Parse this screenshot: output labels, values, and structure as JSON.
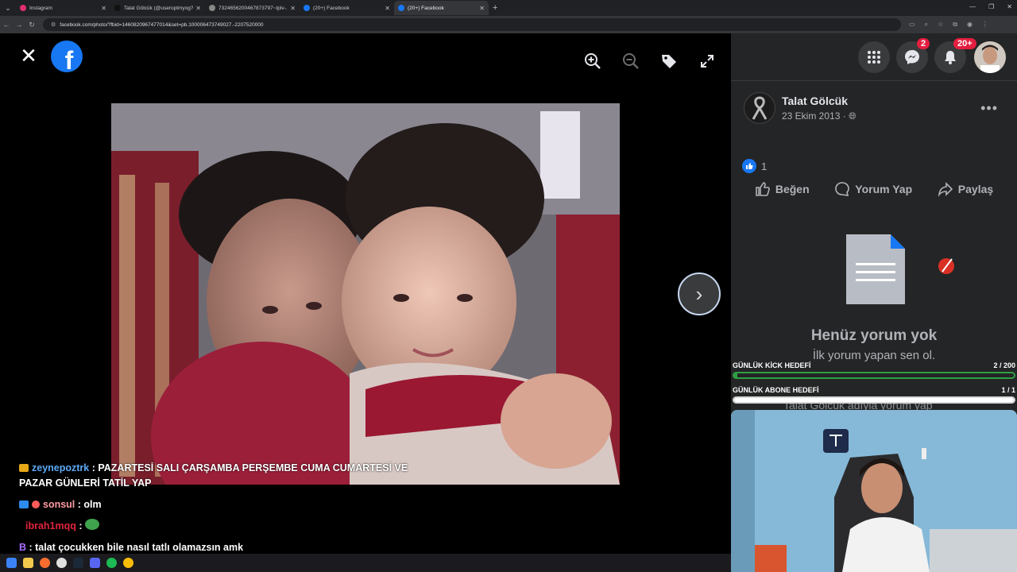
{
  "browser": {
    "tabs": [
      {
        "title": "Instagram",
        "color": "#e1306c",
        "active": false
      },
      {
        "title": "Talat Gölcük (@useroptmyog?...",
        "color": "#111111",
        "active": false
      },
      {
        "title": "7324656200467873797~tplv-...",
        "color": "#888888",
        "active": false
      },
      {
        "title": "(20+) Facebook",
        "color": "#1877f2",
        "active": false
      },
      {
        "title": "(20+) Facebook",
        "color": "#1877f2",
        "active": true
      }
    ],
    "url": "facebook.com/photo/?fbid=1460820967477014&set=pb.100006473749027.-2207520000"
  },
  "viewer": {
    "close_icon": "close-icon",
    "tools": [
      "zoom-in-icon",
      "zoom-out-icon",
      "tag-icon",
      "fullscreen-icon"
    ]
  },
  "chat": [
    {
      "user": "zeynepoztrk",
      "user_color": "#5aa9f5",
      "text": "PAZARTESİ SALI ÇARŞAMBA PERŞEMBE CUMA CUMARTESİ VE PAZAR GÜNLERİ TATİL YAP",
      "badge_color": "#e6a817"
    },
    {
      "user": "sonsul",
      "user_color": "#ff9aa2",
      "text": "olm",
      "badge_color": "#2d8cf0"
    },
    {
      "user": "ibrah1mqq",
      "user_color": "#e0243b",
      "text": "",
      "badge_color": ""
    },
    {
      "user": "",
      "user_color": "#a970ff",
      "text": "talat çocukken bile nasıl tatlı olamazsın amk",
      "badge_color": ""
    }
  ],
  "header": {
    "messenger_badge": "2",
    "notifications_badge": "20+"
  },
  "post": {
    "author": "Talat Gölcük",
    "date": "23 Ekim 2013",
    "like_count": "1",
    "actions": {
      "like": "Beğen",
      "comment": "Yorum Yap",
      "share": "Paylaş"
    },
    "empty_title": "Henüz yorum yok",
    "empty_sub": "İlk yorum yapan sen ol.",
    "comment_placeholder": "Talat Gölcük adıyla yorum yap"
  },
  "goals": [
    {
      "label": "GÜNLÜK KİCK HEDEFİ",
      "value": "2 / 200",
      "progress": 0.01,
      "bar_color": "#2ea043"
    },
    {
      "label": "GÜNLÜK ABONE HEDEFİ",
      "value": "1 / 1",
      "progress": 1.0,
      "bar_color": "#ffffff"
    }
  ],
  "colors": {
    "panel_bg": "#242526",
    "accent": "#1877f2",
    "badge_red": "#e41e3f"
  }
}
